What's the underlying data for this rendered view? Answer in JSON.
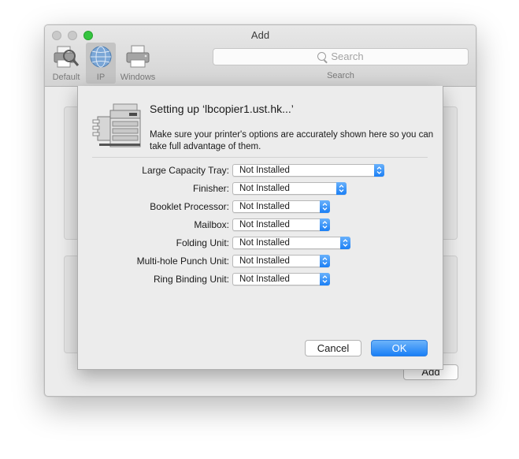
{
  "window": {
    "title": "Add"
  },
  "toolbar": {
    "items": [
      {
        "label": "Default",
        "icon": "default-printer-icon"
      },
      {
        "label": "IP",
        "icon": "globe-icon",
        "selected": true
      },
      {
        "label": "Windows",
        "icon": "windows-printer-icon"
      }
    ],
    "search": {
      "placeholder": "Search",
      "label": "Search"
    }
  },
  "background": {
    "add_label": "Add"
  },
  "sheet": {
    "title": "Setting up ‘lbcopier1.ust.hk...’",
    "description": "Make sure your printer's options are accurately shown here so you can take full advantage of them.",
    "options": [
      {
        "label": "Large Capacity Tray:",
        "value": "Not Installed"
      },
      {
        "label": "Finisher:",
        "value": "Not Installed"
      },
      {
        "label": "Booklet Processor:",
        "value": "Not Installed"
      },
      {
        "label": "Mailbox:",
        "value": "Not Installed"
      },
      {
        "label": "Folding Unit:",
        "value": "Not Installed"
      },
      {
        "label": "Multi-hole Punch Unit:",
        "value": "Not Installed"
      },
      {
        "label": "Ring Binding Unit:",
        "value": "Not Installed"
      }
    ],
    "cancel_label": "Cancel",
    "ok_label": "OK"
  },
  "colors": {
    "accent": "#1a7ff6",
    "zoom_button": "#35c43f"
  }
}
